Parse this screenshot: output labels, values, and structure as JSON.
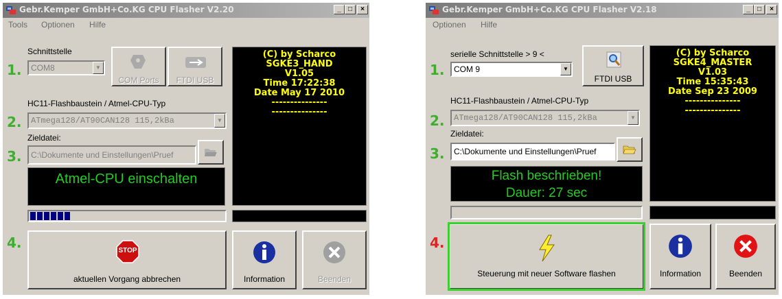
{
  "left": {
    "title": "Gebr.Kemper GmbH+Co.KG CPU Flasher V2.20",
    "menu": [
      "Tools",
      "Optionen",
      "Hilfe"
    ],
    "interface_label": "Schnittstelle",
    "port_value": "COM8",
    "com_ports_label": "COM Ports",
    "ftdi_label": "FTDI USB",
    "cpu_label": "HC11-Flashbaustein / Atmel-CPU-Typ",
    "cpu_value": "ATmega128/AT90CAN128 115,2kBa",
    "target_label": "Zieldatei:",
    "target_value": "C:\\Dokumente und Einstellungen\\Pruef",
    "status_lines": [
      "Atmel-CPU einschalten"
    ],
    "info_lines": [
      "(C) by Scharco",
      "SGKE3_HAND",
      "V1.05",
      "Time 17:22:38",
      "Date May 17 2010",
      "---------------",
      "---------------"
    ],
    "progress": 0.22,
    "action_label": "aktuellen Vorgang abbrechen",
    "stop_text": "STOP",
    "information_label": "Information",
    "exit_label": "Beenden",
    "steps": [
      "1.",
      "2.",
      "3.",
      "4."
    ]
  },
  "right": {
    "title": "Gebr.Kemper GmbH+Co.KG CPU Flasher V2.18",
    "menu": [
      "Optionen",
      "Hilfe"
    ],
    "interface_label": "serielle Schnittstelle > 9 <",
    "port_value": "COM 9",
    "ftdi_label": "FTDI USB",
    "cpu_label": "HC11-Flashbaustein / Atmel-CPU-Typ",
    "cpu_value": "ATmega128/AT90CAN128 115,2kBa",
    "target_label": "Zieldatei:",
    "target_value": "C:\\Dokumente und Einstellungen\\Pruef",
    "status_lines": [
      "Flash beschrieben!",
      "Dauer: 27 sec"
    ],
    "info_lines": [
      "(C) by Scharco",
      "SGKE4_MASTER",
      "V1.03",
      "Time 15:35:43",
      "Date Sep 23 2009",
      "---------------",
      "---------------"
    ],
    "progress": 0,
    "action_label": "Steuerung mit neuer Software flashen",
    "information_label": "Information",
    "exit_label": "Beenden",
    "steps": [
      "1.",
      "2.",
      "3.",
      "4."
    ]
  },
  "colors": {
    "step_green": "#3fae2e",
    "step_red": "#e02424",
    "info_yellow": "#ffff00",
    "status_green": "#22cc22",
    "highlight": "#39d12b"
  }
}
